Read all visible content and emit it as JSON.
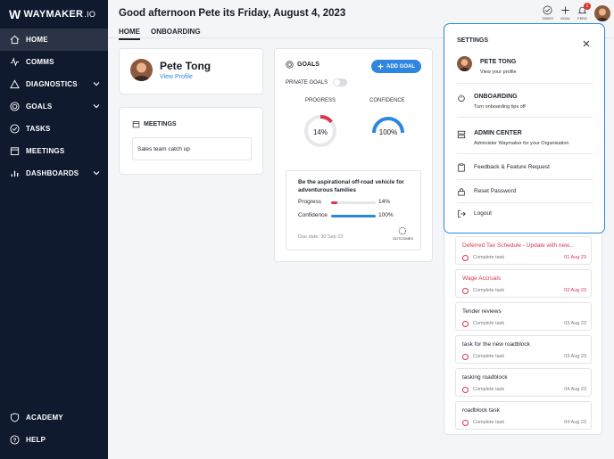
{
  "brand": {
    "name": "WAYMAKER",
    "suffix": ".IO"
  },
  "sidebar": {
    "items": [
      {
        "label": "HOME",
        "icon": "home-icon",
        "active": true
      },
      {
        "label": "COMMS",
        "icon": "pulse-icon"
      },
      {
        "label": "DIAGNOSTICS",
        "icon": "triangle-icon",
        "expandable": true
      },
      {
        "label": "GOALS",
        "icon": "target-icon",
        "expandable": true
      },
      {
        "label": "TASKS",
        "icon": "check-circle-icon"
      },
      {
        "label": "MEETINGS",
        "icon": "calendar-icon"
      },
      {
        "label": "DASHBOARDS",
        "icon": "bar-chart-icon",
        "expandable": true
      }
    ],
    "bottom": [
      {
        "label": "ACADEMY",
        "icon": "shield-icon"
      },
      {
        "label": "HELP",
        "icon": "help-icon"
      }
    ]
  },
  "header": {
    "greeting": "Good afternoon Pete its Friday, August 4, 2023",
    "tabs": [
      {
        "label": "HOME",
        "active": true
      },
      {
        "label": "ONBOARDING"
      }
    ],
    "actions": {
      "tasks": "TASKS",
      "goal": "GOAL",
      "feed": "FEED",
      "feed_count": "1"
    }
  },
  "profile": {
    "name": "Pete Tong",
    "link": "View Profile"
  },
  "meetings": {
    "title": "MEETINGS",
    "items": [
      "Sales team catch up"
    ]
  },
  "goals": {
    "title": "GOALS",
    "add_label": "ADD GOAL",
    "private_label": "PRIVATE GOALS",
    "progress_label": "PROGRESS",
    "confidence_label": "CONFIDENCE",
    "progress_pct": 14,
    "confidence_pct": 100,
    "progress_text": "14%",
    "confidence_text": "100%",
    "item": {
      "name": "Be the aspirational off-road vehicle for adventurous families",
      "progress_label": "Progress",
      "progress_text": "14%",
      "progress_pct": 14,
      "confidence_label": "Confidence",
      "confidence_text": "100%",
      "confidence_pct": 100,
      "due": "Due date: 30 Sep 23",
      "outcomes_label": "OUTCOMES"
    }
  },
  "tasks": [
    {
      "title": "Deferred Tax Schedule - Update with new...",
      "status": "Complete task",
      "date": "01 Aug 23",
      "overdue": true
    },
    {
      "title": "Wage Accruals",
      "status": "Complete task",
      "date": "02 Aug 23",
      "overdue": true
    },
    {
      "title": "Tender reviews",
      "status": "Complete task",
      "date": "03 Aug 23",
      "overdue": false
    },
    {
      "title": "task for the new roadblock",
      "status": "Complete task",
      "date": "03 Aug 23",
      "overdue": false
    },
    {
      "title": "tasking roadblock",
      "status": "Complete task",
      "date": "04 Aug 23",
      "overdue": false
    },
    {
      "title": "roadblock task",
      "status": "Complete task",
      "date": "04 Aug 23",
      "overdue": false
    }
  ],
  "settings": {
    "title": "SETTINGS",
    "profile": {
      "name": "PETE TONG",
      "sub": "View your profile"
    },
    "onboarding": {
      "name": "ONBOARDING",
      "sub": "Turn onboarding tips off"
    },
    "admin": {
      "name": "ADMIN CENTER",
      "sub": "Administer Waymaker for your Organisation"
    },
    "feedback": "Feedback & Feature Request",
    "reset": "Reset Password",
    "logout": "Logout"
  },
  "colors": {
    "sidebar": "#0f1a2e",
    "accent": "#2e86de",
    "progress": "#d93651",
    "overdue": "#d93651"
  }
}
